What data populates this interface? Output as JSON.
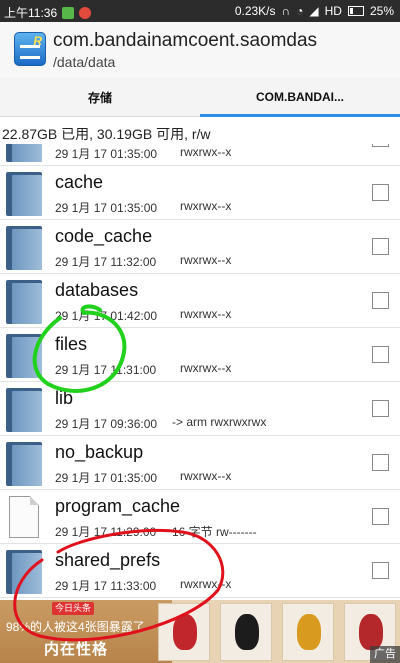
{
  "status_bar": {
    "time": "上午11:36",
    "network_speed": "0.23K/s",
    "network_type": "HD",
    "battery": "25%",
    "icons": [
      "clock-app-icon",
      "weibo-icon",
      "headset-icon",
      "wifi-icon",
      "signal-icon",
      "battery-icon"
    ]
  },
  "header": {
    "title": "com.bandainamcoent.saomdas",
    "path": "/data/data",
    "app_icon_letter": "R"
  },
  "tabs": [
    {
      "label": "存储",
      "selected": false
    },
    {
      "label": "COM.BANDAI...",
      "selected": true
    }
  ],
  "storage_summary": "22.87GB 已用, 30.19GB 可用, r/w",
  "files": [
    {
      "name": "",
      "type": "folder",
      "date": "29 1月 17 01:35:00",
      "perms": "rwxrwx--x"
    },
    {
      "name": "cache",
      "type": "folder",
      "date": "29 1月 17 01:35:00",
      "perms": "rwxrwx--x"
    },
    {
      "name": "code_cache",
      "type": "folder",
      "date": "29 1月 17 11:32:00",
      "perms": "rwxrwx--x"
    },
    {
      "name": "databases",
      "type": "folder",
      "date": "29 1月 17 01:42:00",
      "perms": "rwxrwx--x"
    },
    {
      "name": "files",
      "type": "folder",
      "date": "29 1月 17 11:31:00",
      "perms": "rwxrwx--x"
    },
    {
      "name": "lib",
      "type": "folder",
      "date": "29 1月 17 09:36:00",
      "perms": "-> arm  rwxrwxrwx"
    },
    {
      "name": "no_backup",
      "type": "folder",
      "date": "29 1月 17 01:35:00",
      "perms": "rwxrwx--x"
    },
    {
      "name": "program_cache",
      "type": "file",
      "date": "29 1月 17 11:29:00",
      "perms": "16 字节   rw-------"
    },
    {
      "name": "shared_prefs",
      "type": "folder",
      "date": "29 1月 17 11:33:00",
      "perms": "rwxrwx--x"
    }
  ],
  "ad": {
    "badge": "今日头条",
    "headline": "98%的人被这4张图暴露了",
    "subtext": "内在性格",
    "label": "广告"
  },
  "annotation_colors": {
    "green_circle": "#22d11e",
    "red_circle": "#e0101c"
  }
}
